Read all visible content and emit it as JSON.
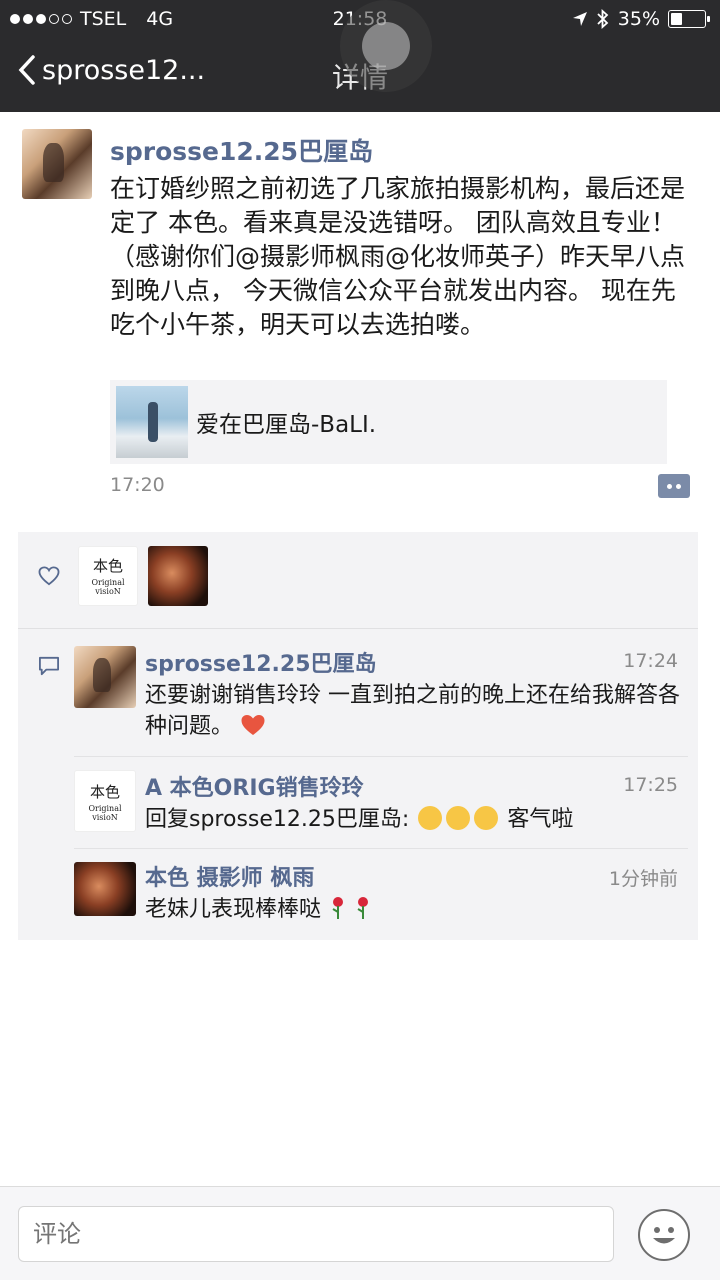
{
  "status": {
    "carrier": "TSEL",
    "network": "4G",
    "time": "21:58",
    "battery": "35%",
    "battery_level": 0.35
  },
  "nav": {
    "back_label": "sprosse12...",
    "title": "详情"
  },
  "post": {
    "author": "sprosse12.25巴厘岛",
    "body": "在订婚纱照之前初选了几家旅拍摄影机构，最后还是定了 本色。看来真是没选错呀。 团队高效且专业！ （感谢你们@摄影师枫雨@化妆师英子）昨天早八点到晚八点， 今天微信公众平台就发出内容。 现在先吃个小午茶，明天可以去选拍喽。",
    "link_title": "爱在巴厘岛-BaLI.",
    "time": "17:20"
  },
  "likes": {
    "icon": "heart-icon",
    "likers": [
      "本色 Original visioN",
      "枫雨"
    ]
  },
  "logo": {
    "line1": "本色",
    "line2": "Original visioN"
  },
  "comments": [
    {
      "name": "sprosse12.25巴厘岛",
      "time": "17:24",
      "text": "还要谢谢销售玲玲 一直到拍之前的晚上还在给我解答各种问题。"
    },
    {
      "name": "A 本色ORIG销售玲玲",
      "time": "17:25",
      "text_prefix": "回复sprosse12.25巴厘岛:",
      "text_suffix": "客气啦"
    },
    {
      "name": "本色 摄影师 枫雨",
      "time": "1分钟前",
      "text": "老妹儿表现棒棒哒"
    }
  ],
  "input": {
    "placeholder": "评论"
  }
}
